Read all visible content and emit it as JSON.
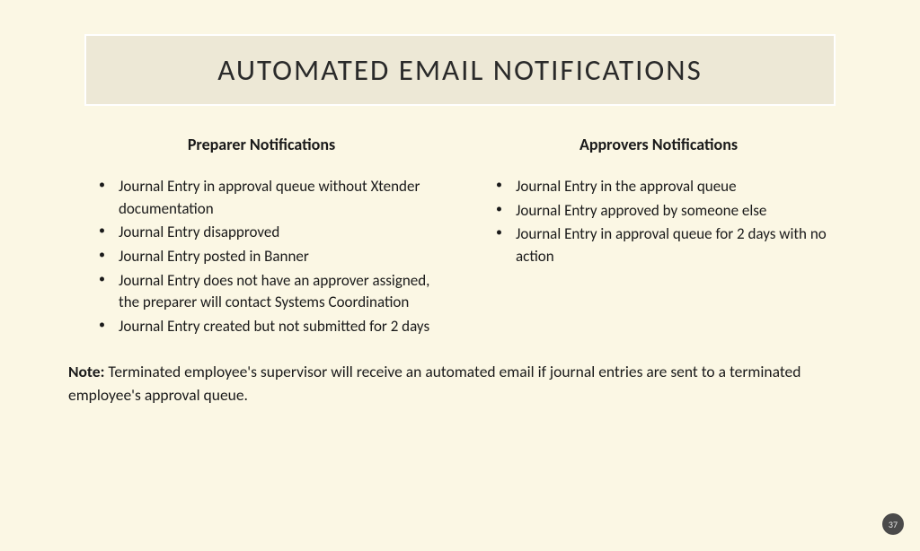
{
  "title": "AUTOMATED EMAIL NOTIFICATIONS",
  "columns": {
    "left": {
      "heading": "Preparer Notifications",
      "items": [
        "Journal Entry in approval queue without Xtender documentation",
        "Journal Entry disapproved",
        "Journal Entry posted in Banner",
        "Journal Entry does not have an approver assigned, the preparer will contact Systems Coordination",
        "Journal Entry created but not submitted for 2 days"
      ]
    },
    "right": {
      "heading": "Approvers Notifications",
      "items": [
        "Journal Entry in the approval queue",
        "Journal Entry approved by someone else",
        "Journal Entry in approval queue for 2 days with no action"
      ]
    }
  },
  "note": {
    "label": "Note:",
    "text": "  Terminated employee's supervisor will receive an automated email if journal entries are sent to a terminated employee's approval queue."
  },
  "page_number": "37"
}
